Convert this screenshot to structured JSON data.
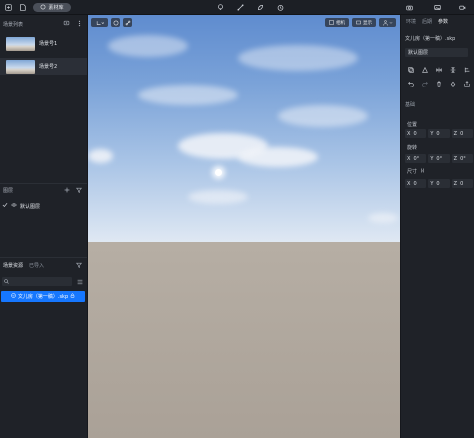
{
  "topbar": {
    "library_label": "素材库"
  },
  "scene_list": {
    "title": "场景列表",
    "items": [
      {
        "label": "场景号1"
      },
      {
        "label": "场景号2"
      }
    ]
  },
  "layers": {
    "title": "图层",
    "items": [
      {
        "label": "默认图层"
      }
    ]
  },
  "resources": {
    "tabs": [
      "场景资源",
      "已导入"
    ],
    "selected_file": "文儿房（第一稿）.skp"
  },
  "viewport": {
    "camera_label": "相机",
    "display_label": "显示"
  },
  "right_panel": {
    "tabs": [
      {
        "label": "环境",
        "active": false
      },
      {
        "label": "后期",
        "active": false
      },
      {
        "label": "参数",
        "active": true
      }
    ],
    "object_name": "文儿房（第一稿）.skp",
    "layer_value": "默认图层",
    "basic_label": "基础",
    "position_label": "位置",
    "rotation_label": "旋转",
    "size_label": "尺寸",
    "position": {
      "x": "0",
      "y": "0",
      "z": "0"
    },
    "rotation": {
      "x": "0°",
      "y": "0°",
      "z": "0°"
    },
    "size": {
      "x": "0",
      "y": "0",
      "z": "0"
    },
    "axis": {
      "x": "X",
      "y": "Y",
      "z": "Z"
    }
  },
  "colors": {
    "accent": "#1677ff",
    "panel": "#1f2228",
    "field": "#2a2e35"
  }
}
